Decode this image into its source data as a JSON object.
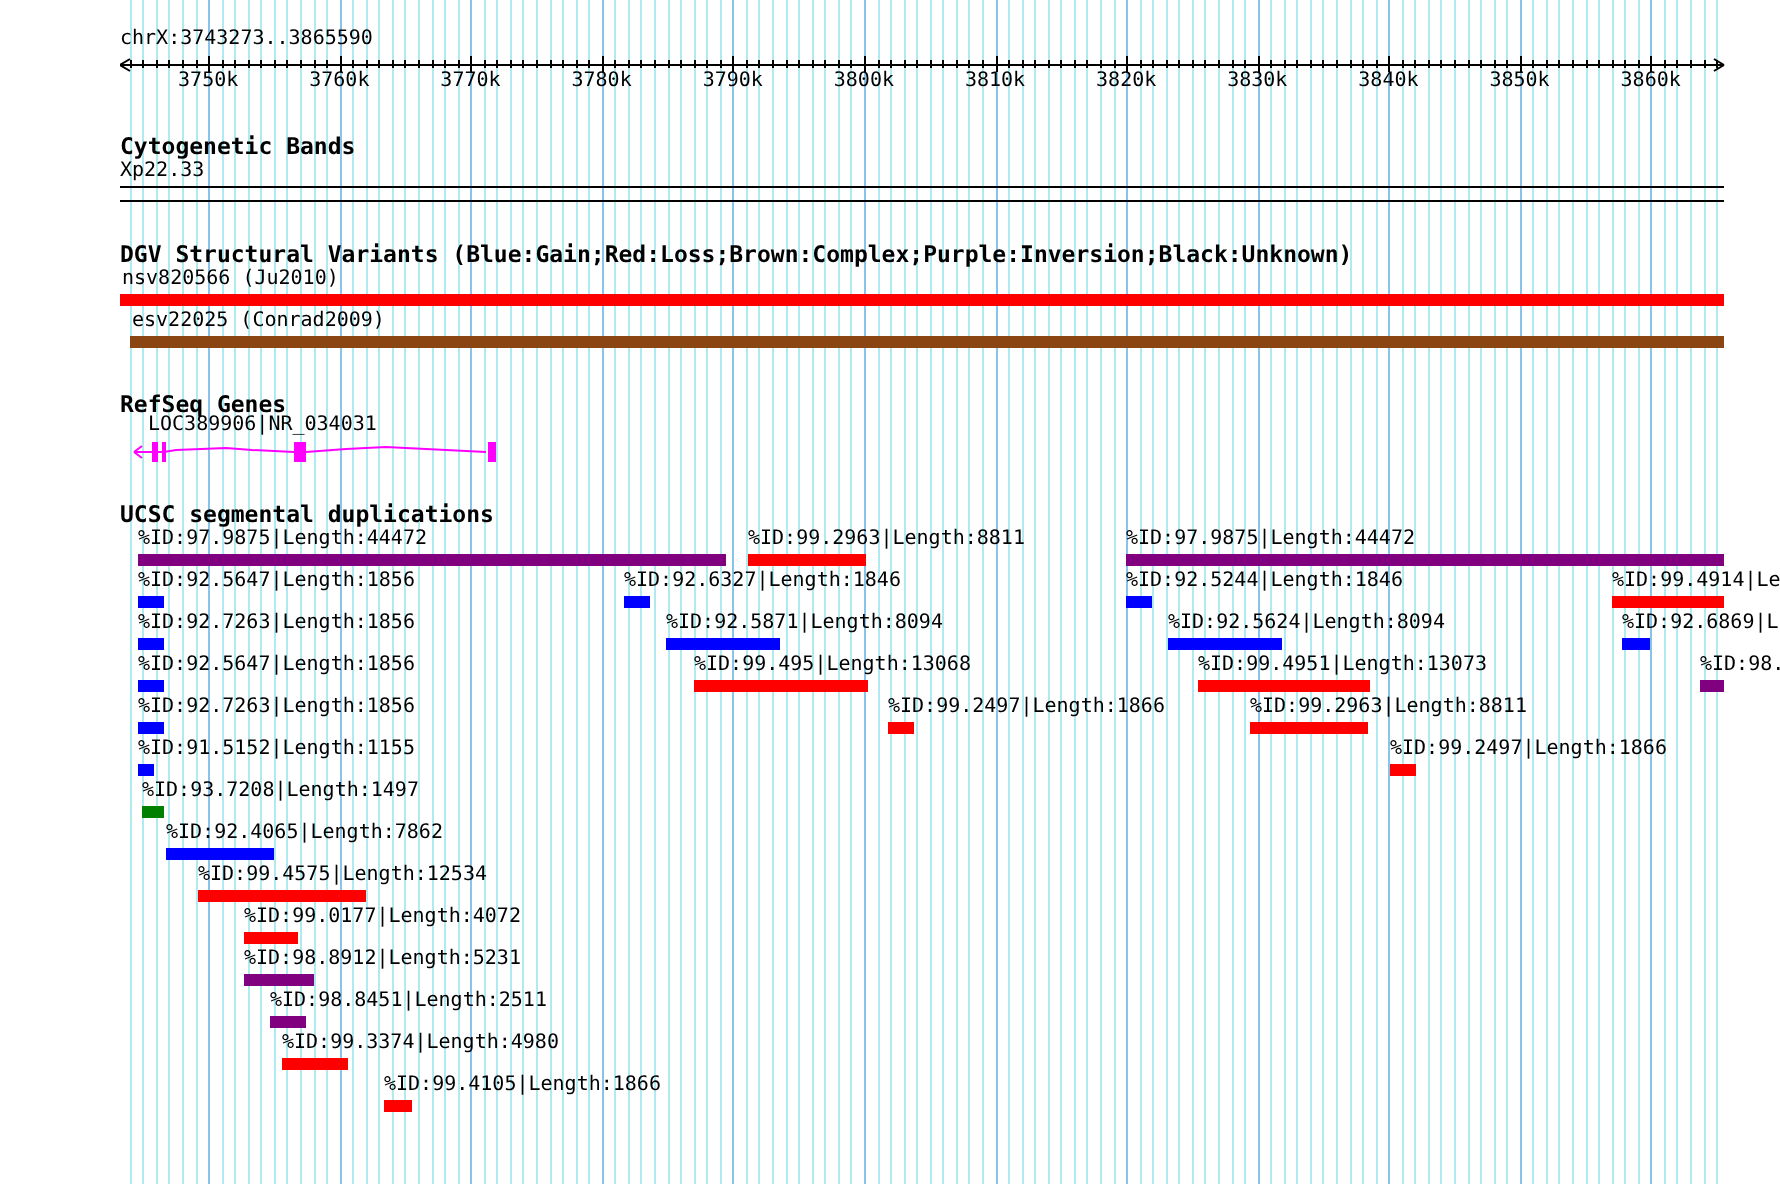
{
  "ruler": {
    "region": "chrX:3743273..3865590",
    "ticks": [
      "3750k",
      "3760k",
      "3770k",
      "3780k",
      "3790k",
      "3800k",
      "3810k",
      "3820k",
      "3830k",
      "3840k",
      "3850k",
      "3860k"
    ]
  },
  "tracks": [
    {
      "kind": "bands",
      "title": "Cytogenetic Bands",
      "features": [
        {
          "label": "Xp22.33"
        }
      ]
    },
    {
      "kind": "variants",
      "title": "DGV Structural Variants (Blue:Gain;Red:Loss;Brown:Complex;Purple:Inversion;Black:Unknown)",
      "features": [
        {
          "label": "nsv820566 (Ju2010)",
          "color": "#ff0000"
        },
        {
          "label": "esv22025 (Conrad2009)",
          "color": "#8b4513"
        }
      ]
    },
    {
      "kind": "genes",
      "title": "RefSeq Genes",
      "features": [
        {
          "label": "LOC389906|NR_034031",
          "color": "#ff00ff"
        }
      ]
    },
    {
      "kind": "duplications",
      "title": "UCSC segmental duplications",
      "rows": [
        [
          {
            "label": "%ID:97.9875|Length:44472",
            "color": "#800080"
          },
          {
            "label": "%ID:99.2963|Length:8811",
            "color": "#ff0000"
          },
          {
            "label": "%ID:97.9875|Length:44472",
            "color": "#800080"
          }
        ],
        [
          {
            "label": "%ID:92.5647|Length:1856",
            "color": "#0000ff"
          },
          {
            "label": "%ID:92.6327|Length:1846",
            "color": "#0000ff"
          },
          {
            "label": "%ID:92.5244|Length:1846",
            "color": "#0000ff"
          },
          {
            "label": "%ID:99.4914|Le",
            "color": "#ff0000"
          }
        ],
        [
          {
            "label": "%ID:92.7263|Length:1856",
            "color": "#0000ff"
          },
          {
            "label": "%ID:92.5871|Length:8094",
            "color": "#0000ff"
          },
          {
            "label": "%ID:92.5624|Length:8094",
            "color": "#0000ff"
          },
          {
            "label": "%ID:92.6869|L",
            "color": "#0000ff"
          }
        ],
        [
          {
            "label": "%ID:92.5647|Length:1856",
            "color": "#0000ff"
          },
          {
            "label": "%ID:99.495|Length:13068",
            "color": "#ff0000"
          },
          {
            "label": "%ID:99.4951|Length:13073",
            "color": "#ff0000"
          },
          {
            "label": "%ID:98.",
            "color": "#800080"
          }
        ],
        [
          {
            "label": "%ID:92.7263|Length:1856",
            "color": "#0000ff"
          },
          {
            "label": "%ID:99.2497|Length:1866",
            "color": "#ff0000"
          },
          {
            "label": "%ID:99.2963|Length:8811",
            "color": "#ff0000"
          }
        ],
        [
          {
            "label": "%ID:91.5152|Length:1155",
            "color": "#0000ff"
          },
          {
            "label": "%ID:99.2497|Length:1866",
            "color": "#ff0000"
          }
        ],
        [
          {
            "label": "%ID:93.7208|Length:1497",
            "color": "#008000"
          }
        ],
        [
          {
            "label": "%ID:92.4065|Length:7862",
            "color": "#0000ff"
          }
        ],
        [
          {
            "label": "%ID:99.4575|Length:12534",
            "color": "#ff0000"
          }
        ],
        [
          {
            "label": "%ID:99.0177|Length:4072",
            "color": "#ff0000"
          }
        ],
        [
          {
            "label": "%ID:98.8912|Length:5231",
            "color": "#800080"
          }
        ],
        [
          {
            "label": "%ID:98.8451|Length:2511",
            "color": "#800080"
          }
        ],
        [
          {
            "label": "%ID:99.3374|Length:4980",
            "color": "#ff0000"
          }
        ],
        [
          {
            "label": "%ID:99.4105|Length:1866",
            "color": "#ff0000"
          }
        ]
      ]
    }
  ]
}
